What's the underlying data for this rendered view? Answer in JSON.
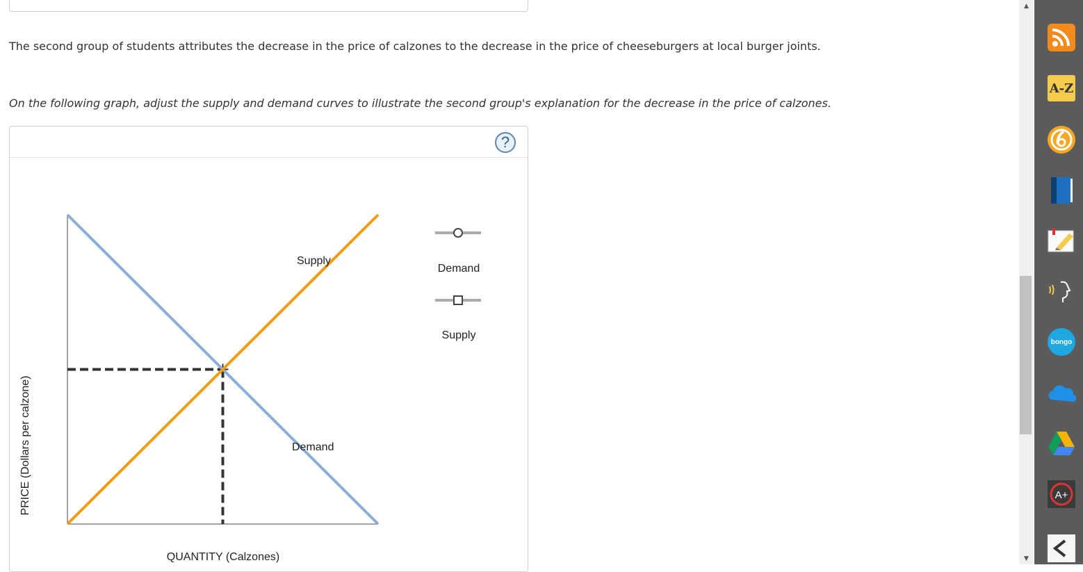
{
  "question": {
    "text_line1": "The second group of students attributes the decrease in the price of calzones to the decrease in the price of cheeseburgers at local burger joints.",
    "text_line2": "On the following graph, adjust the supply and demand curves to illustrate the second group's explanation for the decrease in the price of calzones."
  },
  "graph": {
    "help_label": "?",
    "ylabel": "PRICE (Dollars per calzone)",
    "xlabel": "QUANTITY (Calzones)",
    "supply_label": "Supply",
    "demand_label": "Demand",
    "legend": {
      "demand_label": "Demand",
      "supply_label": "Supply"
    },
    "colors": {
      "demand": "#8aafd6",
      "supply": "#f39c12",
      "equilibrium": "#333333"
    }
  },
  "chart_data": {
    "type": "line",
    "title": "",
    "xlabel": "QUANTITY (Calzones)",
    "ylabel": "PRICE (Dollars per calzone)",
    "xlim": [
      0,
      10
    ],
    "ylim": [
      0,
      10
    ],
    "grid": false,
    "series": [
      {
        "name": "Demand",
        "x": [
          0,
          10
        ],
        "y": [
          10,
          0
        ]
      },
      {
        "name": "Supply",
        "x": [
          0,
          10
        ],
        "y": [
          0,
          10
        ]
      }
    ],
    "equilibrium": {
      "x": 5,
      "y": 5
    },
    "legend_position": "right"
  },
  "toolbar": {
    "icons": [
      "rss-icon",
      "a-z-icon",
      "clock-6-icon",
      "book-icon",
      "highlighter-icon",
      "speech-icon",
      "bongo-icon",
      "onedrive-icon",
      "google-drive-icon",
      "a-plus-icon",
      "collapse-icon"
    ],
    "az_label": "A-Z",
    "bongo_label": "bongo",
    "aplus_label": "A+"
  },
  "scrollbar": {
    "up_arrow": "▲",
    "down_arrow": "▼"
  }
}
